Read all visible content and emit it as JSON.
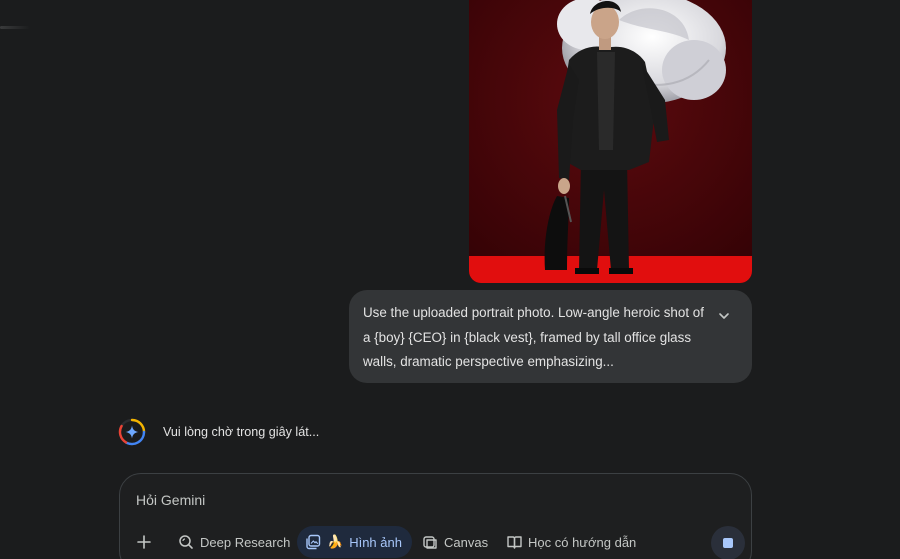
{
  "conversation": {
    "user_prompt": "Use the uploaded portrait photo. Low-angle heroic shot of a {boy} {CEO} in {black vest}, framed by tall office glass walls, dramatic perspective emphasizing...",
    "response_status": "Vui lòng chờ trong giây lát..."
  },
  "input": {
    "placeholder": "Hỏi Gemini"
  },
  "toolbar": {
    "deep_research": "Deep Research",
    "image": "Hình ảnh",
    "image_emoji": "🍌",
    "canvas": "Canvas",
    "guided_learning": "Học có hướng dẫn"
  },
  "icons": {
    "add": "plus-icon",
    "deep_research": "deep-research-icon",
    "image": "image-stack-icon",
    "canvas": "canvas-icon",
    "guided_learning": "book-icon",
    "expand": "chevron-down-icon",
    "stop": "stop-icon",
    "gemini": "gemini-spark-icon"
  },
  "colors": {
    "background": "#1b1c1d",
    "bubble": "#333537",
    "accent": "#a8c7fa",
    "image_background": "#470307",
    "image_floor": "#e10e0e"
  }
}
